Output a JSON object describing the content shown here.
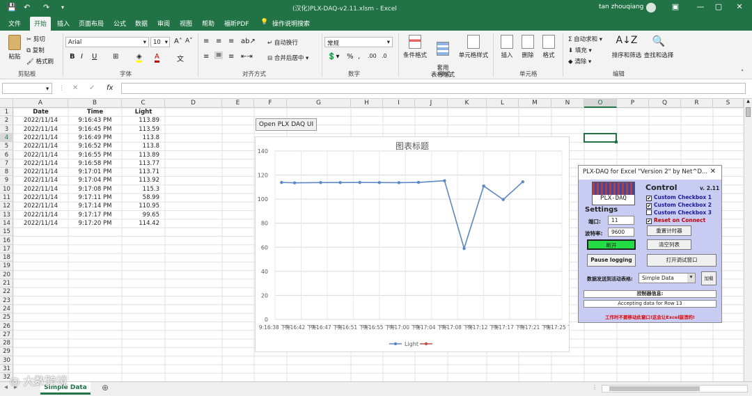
{
  "window": {
    "title": "(汉化)PLX-DAQ-v2.11.xlsm  -  Excel",
    "user": "tan zhouqiang"
  },
  "tabs": [
    "文件",
    "开始",
    "插入",
    "页面布局",
    "公式",
    "数据",
    "审阅",
    "视图",
    "帮助",
    "福昕PDF",
    "操作说明搜索"
  ],
  "ribbon": {
    "clipboard": {
      "paste": "粘贴",
      "cut": "剪切",
      "copy": "复制",
      "format_painter": "格式刷",
      "group": "剪贴板"
    },
    "font": {
      "name": "Arial",
      "size": "10",
      "bold": "B",
      "italic": "I",
      "underline": "U",
      "group": "字体"
    },
    "align": {
      "wrap": "自动换行",
      "merge": "合并后居中",
      "group": "对齐方式"
    },
    "number": {
      "format": "常规",
      "group": "数字"
    },
    "styles": {
      "conditional": "条件格式",
      "table": "套用\n表格格式",
      "cell": "单元格样式",
      "group": "样式"
    },
    "cells": {
      "insert": "插入",
      "delete": "删除",
      "format": "格式",
      "group": "单元格"
    },
    "editing": {
      "autosum": "自动求和",
      "fill": "填充",
      "clear": "清除",
      "sort": "排序和筛选",
      "find": "查找和选择",
      "group": "编辑"
    }
  },
  "formula_bar": {
    "name_box": "",
    "formula": "",
    "fx": "fx"
  },
  "columns": [
    "A",
    "B",
    "C",
    "D",
    "E",
    "F",
    "G",
    "H",
    "I",
    "J",
    "K",
    "L",
    "M",
    "N",
    "O",
    "P",
    "Q",
    "R",
    "S"
  ],
  "rows": [
    "1",
    "2",
    "3",
    "4",
    "5",
    "6",
    "7",
    "8",
    "9",
    "10",
    "11",
    "12",
    "13",
    "14",
    "15",
    "16",
    "17",
    "18",
    "19",
    "20",
    "21",
    "22",
    "23",
    "24",
    "25",
    "26",
    "27",
    "28",
    "29",
    "30",
    "31",
    "32"
  ],
  "table": {
    "headers": [
      "Date",
      "Time",
      "Light"
    ],
    "data": [
      [
        "2022/11/14",
        "9:16:43 PM",
        "113.89"
      ],
      [
        "2022/11/14",
        "9:16:45 PM",
        "113.59"
      ],
      [
        "2022/11/14",
        "9:16:49 PM",
        "113.8"
      ],
      [
        "2022/11/14",
        "9:16:52 PM",
        "113.8"
      ],
      [
        "2022/11/14",
        "9:16:55 PM",
        "113.89"
      ],
      [
        "2022/11/14",
        "9:16:58 PM",
        "113.77"
      ],
      [
        "2022/11/14",
        "9:17:01 PM",
        "113.71"
      ],
      [
        "2022/11/14",
        "9:17:04 PM",
        "113.92"
      ],
      [
        "2022/11/14",
        "9:17:08 PM",
        "115.3"
      ],
      [
        "2022/11/14",
        "9:17:11 PM",
        "58.99"
      ],
      [
        "2022/11/14",
        "9:17:14 PM",
        "110.95"
      ],
      [
        "2022/11/14",
        "9:17:17 PM",
        "99.65"
      ],
      [
        "2022/11/14",
        "9:17:20 PM",
        "114.42"
      ]
    ]
  },
  "open_button": "Open PLX DAQ UI",
  "chart_data": {
    "type": "line",
    "title": "图表标题",
    "categories": [
      "9:16:38 下午",
      "9:16:42 下午",
      "9:16:47 下午",
      "9:16:51 下午",
      "9:16:55 下午",
      "9:17:00 下午",
      "9:17:04 下午",
      "9:17:08 下午",
      "9:17:12 下午",
      "9:17:17 下午",
      "9:17:21 下午",
      "9:17:25 下午"
    ],
    "x_seconds": [
      5,
      7,
      11,
      14,
      17,
      20,
      23,
      26,
      30,
      33,
      36,
      39,
      42
    ],
    "series": [
      {
        "name": "Light",
        "color": "#5b87c7",
        "values": [
          113.89,
          113.59,
          113.8,
          113.8,
          113.89,
          113.77,
          113.71,
          113.92,
          115.3,
          58.99,
          110.95,
          99.65,
          114.42
        ]
      },
      {
        "name": "",
        "color": "#c0504d",
        "values": []
      }
    ],
    "ylim": [
      0,
      140
    ],
    "yticks": [
      0,
      20,
      40,
      60,
      80,
      100,
      120,
      140
    ],
    "grid": true,
    "legend": "bottom"
  },
  "dialog": {
    "title": "PLX-DAQ for Excel \"Version 2\" by Net^D...",
    "logo": "PLX-DAQ",
    "control": "Control",
    "version": "v. 2.11",
    "checkboxes": [
      {
        "label": "Custom Checkbox 1",
        "checked": "✔"
      },
      {
        "label": "Custom Checkbox 2",
        "checked": "✔"
      },
      {
        "label": "Custom Checkbox 3",
        "checked": ""
      },
      {
        "label": "Reset on Connect",
        "checked": "✔"
      }
    ],
    "settings": "Settings",
    "port_label": "端口:",
    "port": "11",
    "baud_label": "波特率:",
    "baud": "9600",
    "reset_timer": "重置计时器",
    "disconnect": "断开",
    "clear_columns": "清空列表",
    "pause": "Pause logging",
    "open_debug": "打开调试窗口",
    "send_label": "数据发送到活动表格:",
    "sheet": "Simple Data",
    "load": "加载",
    "controller_info": "控制器信息:",
    "status": "Accepting data for Row 13",
    "warning": "工作时不要移动此窗口!这会让Excel崩溃的!"
  },
  "sheet_tab": "Simple Data",
  "watermark": "大数跨境"
}
